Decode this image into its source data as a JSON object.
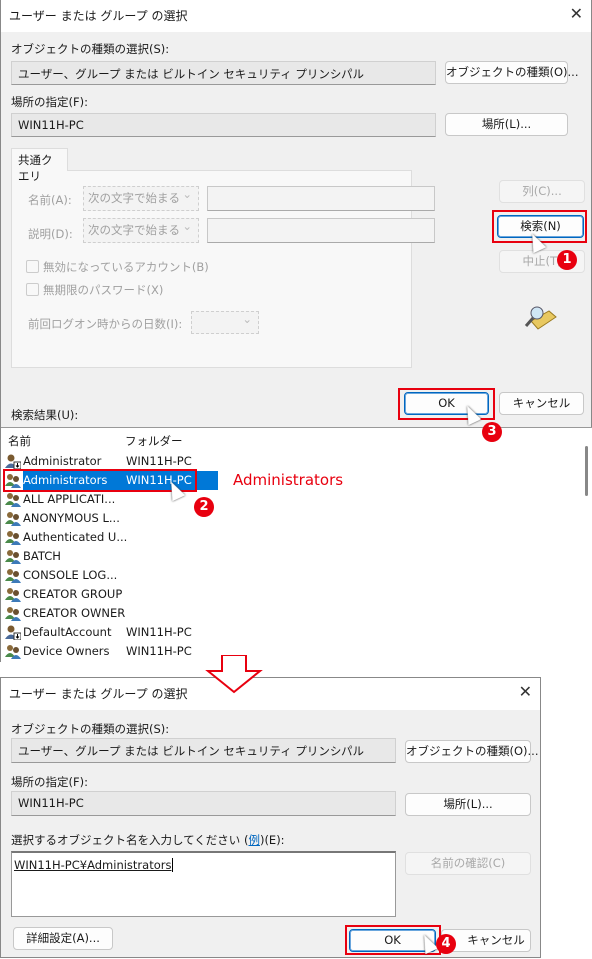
{
  "dialog1": {
    "title": "ユーザー または グループ の選択",
    "object_type_label": "オブジェクトの種類の選択(S):",
    "object_type_value": "ユーザー、グループ または ビルトイン セキュリティ プリンシパル",
    "object_type_button": "オブジェクトの種類(O)...",
    "location_label": "場所の指定(F):",
    "location_value": "WIN11H-PC",
    "location_button": "場所(L)...",
    "tab": "共通クエリ",
    "name_label": "名前(A):",
    "name_mode": "次の文字で始まる",
    "desc_label": "説明(D):",
    "desc_mode": "次の文字で始まる",
    "disabled_accounts": "無効になっているアカウント(B)",
    "nonexpiring_pw": "無期限のパスワード(X)",
    "days_since_logon": "前回ログオン時からの日数(I):",
    "columns_button": "列(C)...",
    "search_button": "検索(N)",
    "stop_button": "中止(T)",
    "ok_button": "OK",
    "cancel_button": "キャンセル",
    "results_label": "検索結果(U):",
    "columns": [
      "名前",
      "フォルダー"
    ],
    "rows": [
      {
        "name": "Administrator",
        "folder": "WIN11H-PC",
        "icon": "user-icon"
      },
      {
        "name": "Administrators",
        "folder": "WIN11H-PC",
        "icon": "group-icon",
        "selected": true
      },
      {
        "name": "ALL APPLICATI...",
        "folder": "",
        "icon": "group-icon"
      },
      {
        "name": "ANONYMOUS L...",
        "folder": "",
        "icon": "group-icon"
      },
      {
        "name": "Authenticated U...",
        "folder": "",
        "icon": "group-icon"
      },
      {
        "name": "BATCH",
        "folder": "",
        "icon": "group-icon"
      },
      {
        "name": "CONSOLE LOG...",
        "folder": "",
        "icon": "group-icon"
      },
      {
        "name": "CREATOR GROUP",
        "folder": "",
        "icon": "group-icon"
      },
      {
        "name": "CREATOR OWNER",
        "folder": "",
        "icon": "group-icon"
      },
      {
        "name": "DefaultAccount",
        "folder": "WIN11H-PC",
        "icon": "user-icon"
      },
      {
        "name": "Device Owners",
        "folder": "WIN11H-PC",
        "icon": "group-icon"
      }
    ]
  },
  "annotation": {
    "selected_label": "Administrators",
    "steps": [
      "1",
      "2",
      "3",
      "4"
    ],
    "color": "#e8000f"
  },
  "dialog2": {
    "title": "ユーザー または グループ の選択",
    "object_type_label": "オブジェクトの種類の選択(S):",
    "object_type_value": "ユーザー、グループ または ビルトイン セキュリティ プリンシパル",
    "object_type_button": "オブジェクトの種類(O)...",
    "location_label": "場所の指定(F):",
    "location_value": "WIN11H-PC",
    "location_button": "場所(L)...",
    "enter_label_pre": "選択するオブジェクト名を入力してください (",
    "enter_label_link": "例",
    "enter_label_post": ")(E):",
    "enter_value": "WIN11H-PC¥Administrators",
    "check_names_button": "名前の確認(C)",
    "advanced_button": "詳細設定(A)...",
    "ok_button": "OK",
    "cancel_button": "キャンセル"
  },
  "colors": {
    "selection": "#0078d7",
    "accent": "#0067c0"
  }
}
